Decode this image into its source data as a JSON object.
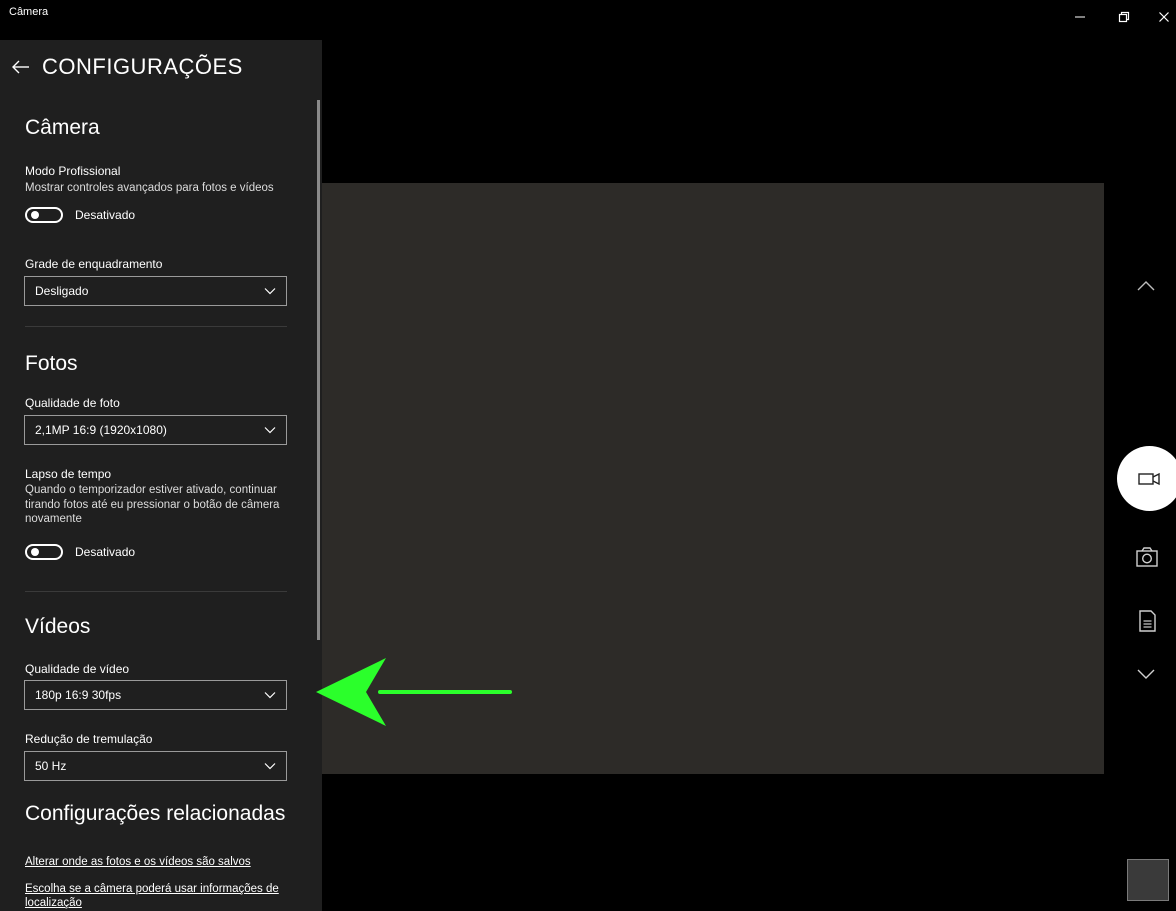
{
  "window": {
    "title": "Câmera",
    "controls": {
      "minimize": "–",
      "maximize": "⧉",
      "close": "✕"
    }
  },
  "panel": {
    "title": "CONFIGURAÇÕES",
    "camera": {
      "heading": "Câmera",
      "pro_mode_label": "Modo Profissional",
      "pro_mode_desc": "Mostrar controles avançados para fotos e vídeos",
      "pro_mode_state": "Desativado",
      "grid_label": "Grade de enquadramento",
      "grid_value": "Desligado"
    },
    "photos": {
      "heading": "Fotos",
      "quality_label": "Qualidade de foto",
      "quality_value": "2,1MP 16:9 (1920x1080)",
      "timelapse_label": "Lapso de tempo",
      "timelapse_desc": "Quando o temporizador estiver ativado, continuar tirando fotos até eu pressionar o botão de câmera novamente",
      "timelapse_state": "Desativado"
    },
    "videos": {
      "heading": "Vídeos",
      "quality_label": "Qualidade de vídeo",
      "quality_value": "180p 16:9 30fps",
      "flicker_label": "Redução de tremulação",
      "flicker_value": "50 Hz"
    },
    "related": {
      "heading": "Configurações relacionadas",
      "link_storage": "Alterar onde as fotos e os vídeos são salvos",
      "link_location": "Escolha se a câmera poderá usar informações de localização"
    }
  },
  "icons": {
    "back": "back-arrow-icon",
    "up": "chevron-up-icon",
    "video": "video-camera-icon",
    "photo": "photo-camera-icon",
    "document": "document-icon",
    "down": "chevron-down-icon"
  },
  "colors": {
    "panel_bg": "#1f1f1f",
    "preview_bg": "#2d2b28",
    "annotation": "#2bff2b"
  }
}
